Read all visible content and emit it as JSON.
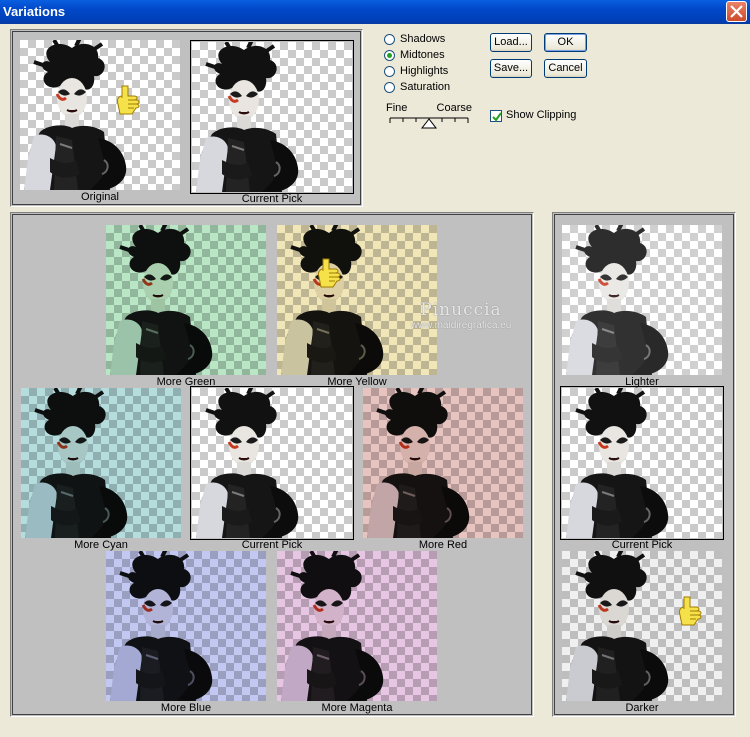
{
  "window": {
    "title": "Variations"
  },
  "preview": {
    "original_caption": "Original",
    "current_caption": "Current Pick"
  },
  "options": {
    "radios": [
      {
        "label": "Shadows",
        "selected": false
      },
      {
        "label": "Midtones",
        "selected": true
      },
      {
        "label": "Highlights",
        "selected": false
      },
      {
        "label": "Saturation",
        "selected": false
      }
    ],
    "fine_label": "Fine",
    "coarse_label": "Coarse",
    "show_clipping_label": "Show Clipping",
    "show_clipping_checked": true
  },
  "buttons": {
    "load": "Load...",
    "save": "Save...",
    "ok": "OK",
    "cancel": "Cancel"
  },
  "variations": {
    "more_green": "More Green",
    "more_yellow": "More Yellow",
    "more_cyan": "More Cyan",
    "current_pick": "Current Pick",
    "more_red": "More Red",
    "more_blue": "More Blue",
    "more_magenta": "More Magenta"
  },
  "brightness": {
    "lighter": "Lighter",
    "current_pick": "Current Pick",
    "darker": "Darker"
  },
  "watermark": {
    "line1": "Pinuccia",
    "line2": "www.maidiregrafica.eu"
  },
  "icons": {
    "pointer": "pointing-hand-icon",
    "close": "close-icon",
    "check": "check-icon"
  },
  "colors": {
    "titlebar": "#0047c8",
    "dialog_bg": "#ece9d8",
    "panel_bg": "#c0c0c0",
    "green_tint": "#b9e6c4",
    "yellow_tint": "#f0e6b8",
    "cyan_tint": "#b6ddde",
    "red_tint": "#e8c4c0",
    "blue_tint": "#c2c8f2",
    "magenta_tint": "#e6c6e2"
  }
}
